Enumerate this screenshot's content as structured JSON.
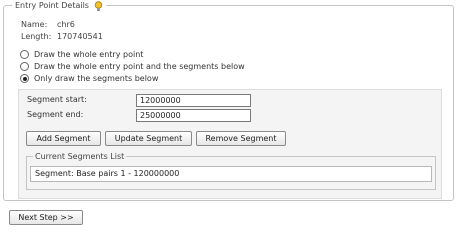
{
  "entry_point": {
    "legend": "Entry Point Details",
    "name_label": "Name:",
    "name_value": "chr6",
    "length_label": "Length:",
    "length_value": "170740541"
  },
  "draw_options": [
    {
      "label": "Draw the whole entry point",
      "selected": false
    },
    {
      "label": "Draw the whole entry point and the segments below",
      "selected": false
    },
    {
      "label": "Only draw the segments below",
      "selected": true
    }
  ],
  "segment_form": {
    "start_label": "Segment start:",
    "start_value": "12000000",
    "end_label": "Segment end:",
    "end_value": "25000000"
  },
  "buttons": {
    "add": "Add Segment",
    "update": "Update Segment",
    "remove": "Remove Segment",
    "next": "Next Step >>"
  },
  "segments_list": {
    "legend": "Current Segments List",
    "items": [
      "Segment: Base pairs 1 - 120000000"
    ]
  }
}
